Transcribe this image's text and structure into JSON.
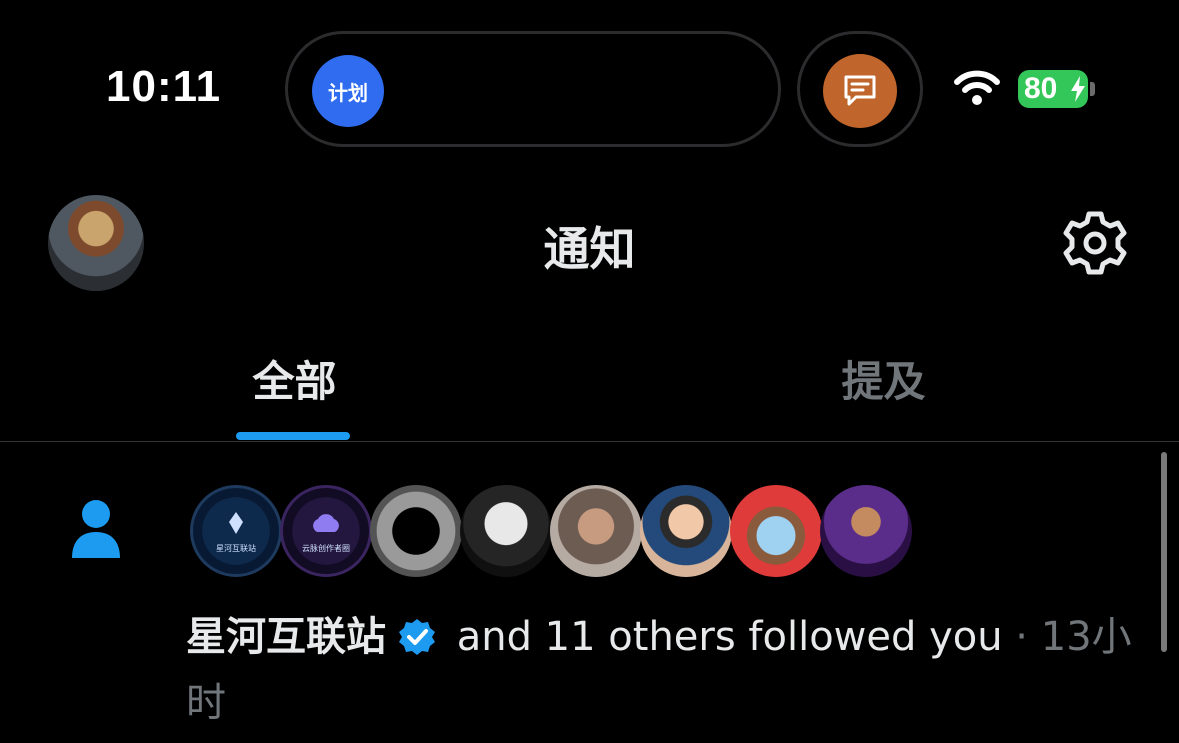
{
  "status_bar": {
    "time": "10:11",
    "island_badge": "计划",
    "battery": "80"
  },
  "header": {
    "title": "通知"
  },
  "tabs": [
    {
      "label": "全部",
      "selected": true
    },
    {
      "label": "提及",
      "selected": false
    }
  ],
  "notification": {
    "name": "星河互联站",
    "verified": true,
    "text": " and 11 others followed you",
    "separator": " · ",
    "time": "13小时",
    "avatar_labels": [
      "星河互联站",
      "云脉创作者圈"
    ]
  },
  "colors": {
    "accent": "#1d9bf0",
    "island_badge": "#2f6cf0",
    "message_badge": "#c0652c",
    "battery": "#33c759"
  }
}
